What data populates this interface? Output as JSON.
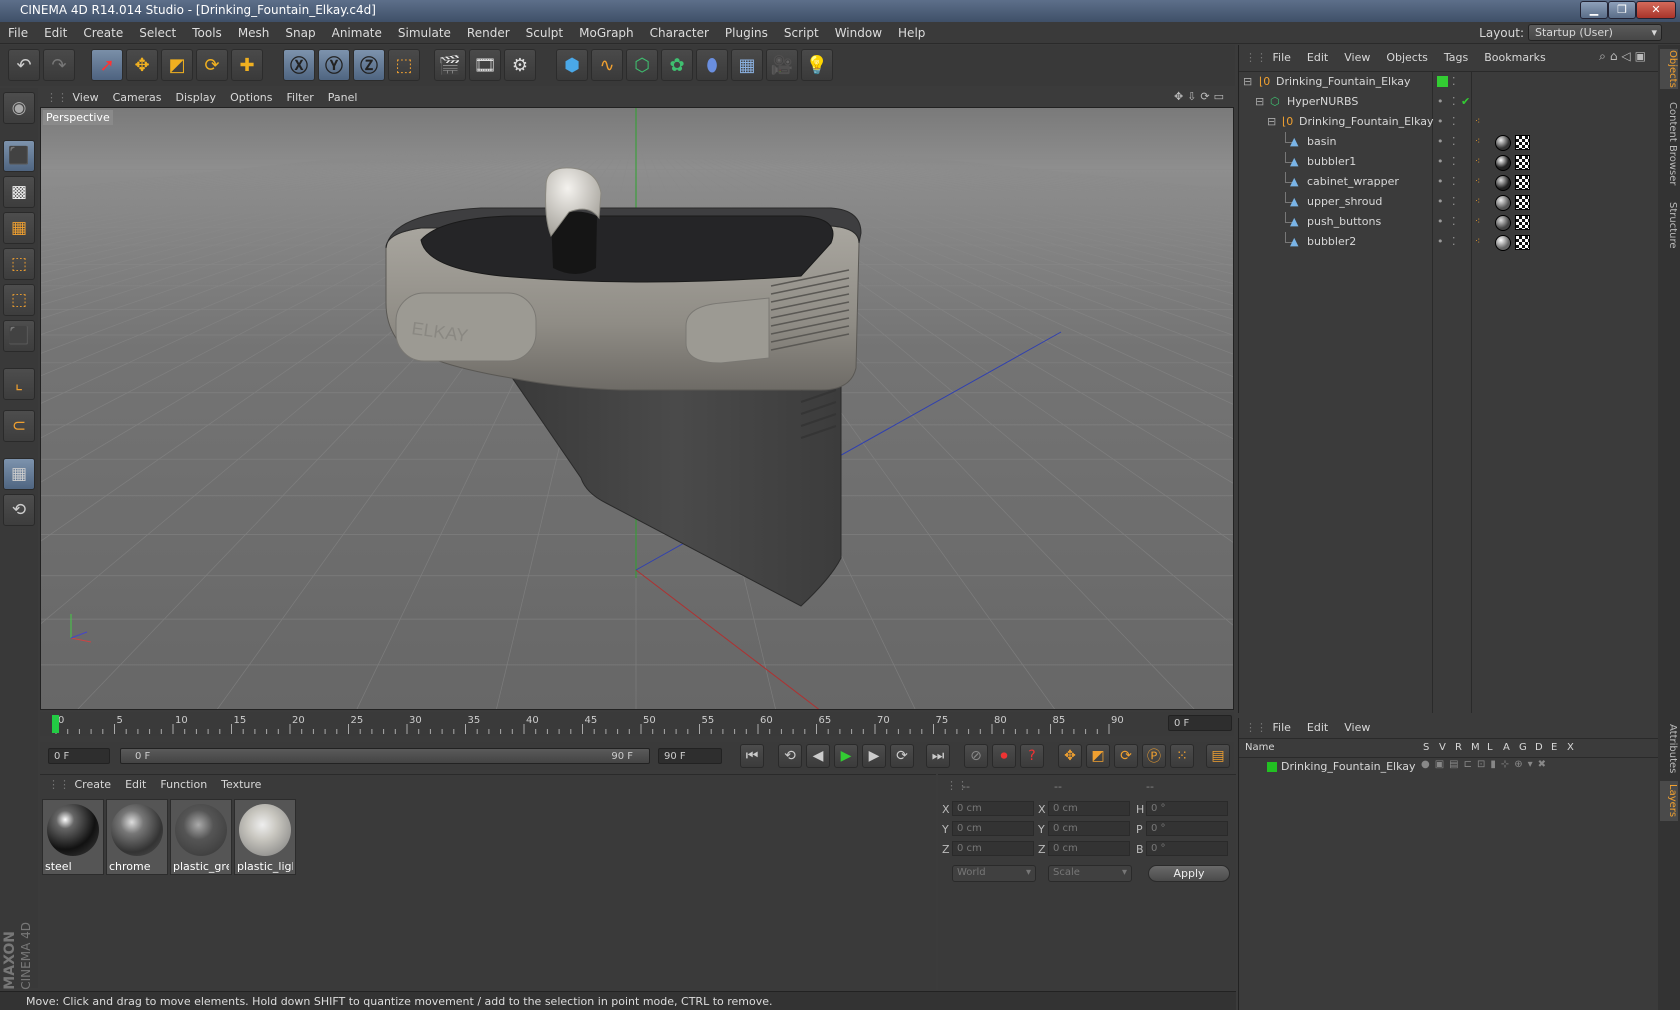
{
  "window": {
    "title": "CINEMA 4D R14.014 Studio - [Drinking_Fountain_Elkay.c4d]"
  },
  "menu": [
    "File",
    "Edit",
    "Create",
    "Select",
    "Tools",
    "Mesh",
    "Snap",
    "Animate",
    "Simulate",
    "Render",
    "Sculpt",
    "MoGraph",
    "Character",
    "Plugins",
    "Script",
    "Window",
    "Help"
  ],
  "layout": {
    "label": "Layout:",
    "value": "Startup (User)"
  },
  "toolbar_icons": [
    "undo-icon",
    "redo-icon",
    "live-select-icon",
    "move-icon",
    "scale-icon",
    "rotate-icon",
    "add-icon",
    "x-axis-icon",
    "y-axis-icon",
    "z-axis-icon",
    "coord-system-icon",
    "render-view-icon",
    "render-picture-icon",
    "render-settings-icon",
    "cube-icon",
    "spline-icon",
    "nurbs-icon",
    "array-icon",
    "deformer-icon",
    "floor-icon",
    "camera-icon",
    "light-icon"
  ],
  "viewport": {
    "menu": [
      "View",
      "Cameras",
      "Display",
      "Options",
      "Filter",
      "Panel"
    ],
    "label": "Perspective",
    "brand_text": "ELKAY"
  },
  "timeline": {
    "ticks": [
      "0",
      "5",
      "10",
      "15",
      "20",
      "25",
      "30",
      "35",
      "40",
      "45",
      "50",
      "55",
      "60",
      "65",
      "70",
      "75",
      "80",
      "85",
      "90"
    ],
    "current_frame": "0 F",
    "start_field": "0 F",
    "range_start": "0 F",
    "range_end": "90 F",
    "end_field": "90 F"
  },
  "materials": {
    "menu": [
      "Create",
      "Edit",
      "Function",
      "Texture"
    ],
    "items": [
      "steel",
      "chrome",
      "plastic_gre",
      "plastic_ligh"
    ]
  },
  "coords": {
    "headers": [
      "--",
      "--",
      "--"
    ],
    "rows": [
      {
        "a": "X",
        "av": "0 cm",
        "b": "X",
        "bv": "0 cm",
        "c": "H",
        "cv": "0 °"
      },
      {
        "a": "Y",
        "av": "0 cm",
        "b": "Y",
        "bv": "0 cm",
        "c": "P",
        "cv": "0 °"
      },
      {
        "a": "Z",
        "av": "0 cm",
        "b": "Z",
        "bv": "0 cm",
        "c": "B",
        "cv": "0 °"
      }
    ],
    "world": "World",
    "scale": "Scale",
    "apply": "Apply"
  },
  "objects": {
    "menu": [
      "File",
      "Edit",
      "View",
      "Objects",
      "Tags",
      "Bookmarks"
    ],
    "rows": [
      {
        "name": "Drinking_Fountain_Elkay"
      },
      {
        "name": "HyperNURBS"
      },
      {
        "name": "Drinking_Fountain_Elkay"
      },
      {
        "name": "basin"
      },
      {
        "name": "bubbler1"
      },
      {
        "name": "cabinet_wrapper"
      },
      {
        "name": "upper_shroud"
      },
      {
        "name": "push_buttons"
      },
      {
        "name": "bubbler2"
      }
    ]
  },
  "layers": {
    "menu": [
      "File",
      "Edit",
      "View"
    ],
    "columns": [
      "Name",
      "S",
      "V",
      "R",
      "M",
      "L",
      "A",
      "G",
      "D",
      "E",
      "X"
    ],
    "rows": [
      {
        "name": "Drinking_Fountain_Elkay",
        "color": "#22c022"
      }
    ]
  },
  "right_tabs": [
    "Objects",
    "Content Browser",
    "Structure",
    "Attributes",
    "Layers"
  ],
  "logo": {
    "line1": "MAXON",
    "line2": "CINEMA 4D"
  },
  "status": "Move: Click and drag to move elements. Hold down SHIFT to quantize movement / add to the selection in point mode, CTRL to remove."
}
